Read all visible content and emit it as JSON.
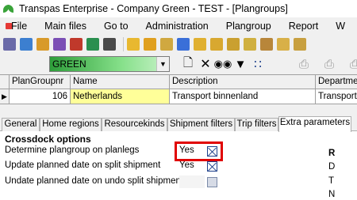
{
  "window": {
    "title": "Transpas Enterprise - Company Green - TEST - [Plangroups]"
  },
  "menu": {
    "items": [
      {
        "label": "File"
      },
      {
        "label": "Main files"
      },
      {
        "label": "Go to"
      },
      {
        "label": "Administration"
      },
      {
        "label": "Plangroup"
      },
      {
        "label": "Report"
      },
      {
        "label": "W"
      }
    ]
  },
  "toolbar": {
    "company_combo": {
      "value": "GREEN"
    },
    "icons": [
      "new-icon",
      "delete-icon",
      "find-icon",
      "filter-icon",
      "tree-icon",
      "print-icon",
      "print-preview-icon",
      "export-icon"
    ]
  },
  "grid": {
    "columns": [
      "PlanGroupnr",
      "Name",
      "Description",
      "Departmen"
    ],
    "rows": [
      {
        "plangroupnr": "106",
        "name": "Netherlands",
        "description": "Transport binnenland",
        "department": "Transport"
      }
    ]
  },
  "tabs": {
    "items": [
      {
        "label": "General"
      },
      {
        "label": "Home regions"
      },
      {
        "label": "Resourcekinds"
      },
      {
        "label": "Shipment filters"
      },
      {
        "label": "Trip filters"
      },
      {
        "label": "Extra parameters"
      }
    ],
    "active": "Extra parameters"
  },
  "crossdock": {
    "title": "Crossdock options",
    "options": [
      {
        "label": "Determine plangroup on planlegs",
        "value": "Yes",
        "checked": true
      },
      {
        "label": "Update planned date on split shipment",
        "value": "Yes",
        "checked": true
      },
      {
        "label": "Undate planned date on undo split shipment",
        "value": "",
        "checked": false
      }
    ]
  },
  "right_column": {
    "labels": [
      "R",
      "D",
      "T",
      "N"
    ]
  },
  "colors": {
    "highlight": "#e00000",
    "combo_green": "#2e9e3a",
    "name_cell": "#ffff99"
  }
}
